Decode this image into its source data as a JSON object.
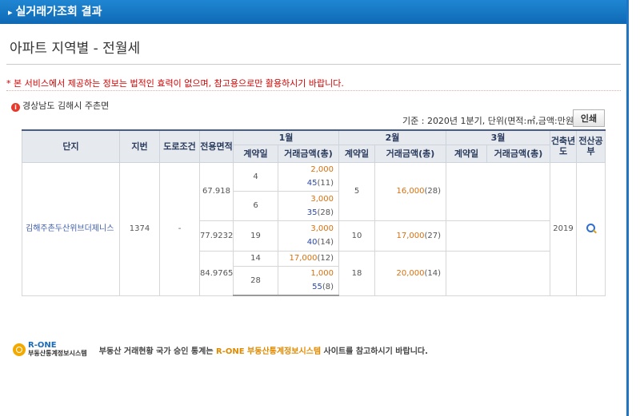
{
  "titlebar": {
    "title": "실거래가조회 결과"
  },
  "heading": "아파트 지역별 - 전월세",
  "notice": "* 본 서비스에서 제공하는 정보는 법적인 효력이 없으며, 참고용으로만 활용하시기 바랍니다.",
  "region": "경상남도 김해시 주촌면",
  "basis": "기준 : 2020년 1분기, 단위(면적:㎡,금액:만원)",
  "print_label": "인쇄",
  "headers": {
    "complex": "단지",
    "jibun": "지번",
    "road": "도로조건",
    "area": "전용면적",
    "months": [
      "1월",
      "2월",
      "3월"
    ],
    "contract_day": "계약일",
    "amount": "거래금액(총)",
    "year_built": "건축년도",
    "registry": "전산공부"
  },
  "row": {
    "complex": "김해주촌두산위브더제니스",
    "jibun": "1374",
    "road": "-",
    "year_built": "2019"
  },
  "areas": [
    {
      "area": "67.918",
      "m1": [
        {
          "day": "4",
          "deposit": "2,000",
          "rent": "45",
          "count": "(11)"
        },
        {
          "day": "6",
          "deposit": "3,000",
          "rent": "35",
          "count": "(28)"
        }
      ],
      "m2": {
        "day": "5",
        "deposit": "16,000",
        "count": "(28)"
      }
    },
    {
      "area": "77.9232",
      "m1": [
        {
          "day": "19",
          "deposit": "3,000",
          "rent": "40",
          "count": "(14)"
        }
      ],
      "m2": {
        "day": "10",
        "deposit": "17,000",
        "count": "(27)"
      }
    },
    {
      "area": "84.9765",
      "m1": [
        {
          "day": "14",
          "deposit": "17,000",
          "rent": "",
          "count": "(12)"
        },
        {
          "day": "28",
          "deposit": "1,000",
          "rent": "55",
          "count": "(8)"
        }
      ],
      "m2": {
        "day": "18",
        "deposit": "20,000",
        "count": "(14)"
      }
    }
  ],
  "footer": {
    "logo_name": "R-ONE",
    "logo_sub": "부동산통계정보시스템",
    "msg_prefix": "부동산 거래현황 국가 승인 통계는",
    "msg_highlight": "R-ONE 부동산통계정보시스템",
    "msg_suffix": "사이트를 참고하시기 바랍니다."
  },
  "colors": {
    "header_blue": "#1f86d3",
    "deposit": "#d8700e",
    "rent": "#2b47a6",
    "notice": "#d40000"
  }
}
